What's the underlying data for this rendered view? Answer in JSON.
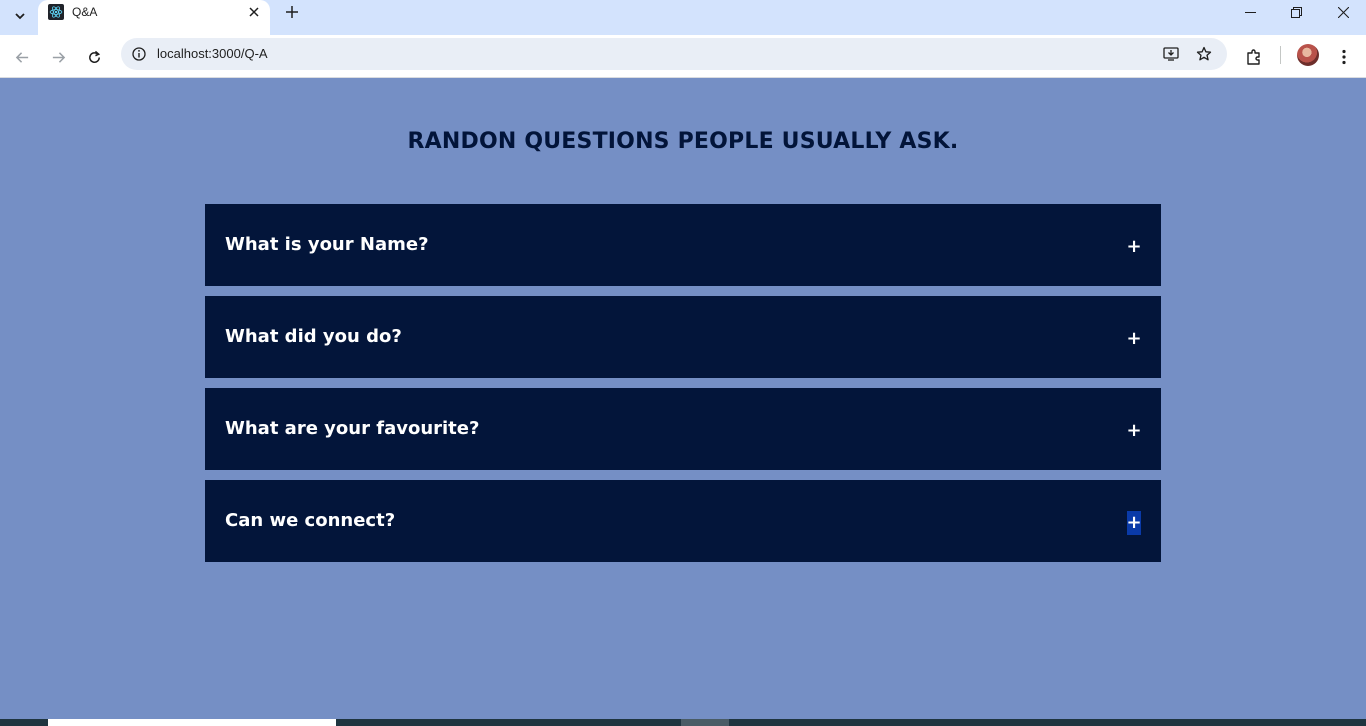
{
  "browser": {
    "tab_title": "Q&A",
    "url": "localhost:3000/Q-A"
  },
  "page": {
    "title": "RANDON QUESTIONS PEOPLE USUALLY ASK.",
    "faq": [
      {
        "question": "What is your Name?",
        "toggle": "+"
      },
      {
        "question": "What did you do?",
        "toggle": "+"
      },
      {
        "question": "What are your favourite?",
        "toggle": "+"
      },
      {
        "question": "Can we connect?",
        "toggle": "+"
      }
    ]
  },
  "colors": {
    "page_background": "#758fc5",
    "card_background": "#03153a",
    "title_text": "#021439",
    "focused_toggle": "#0a3aa8"
  }
}
